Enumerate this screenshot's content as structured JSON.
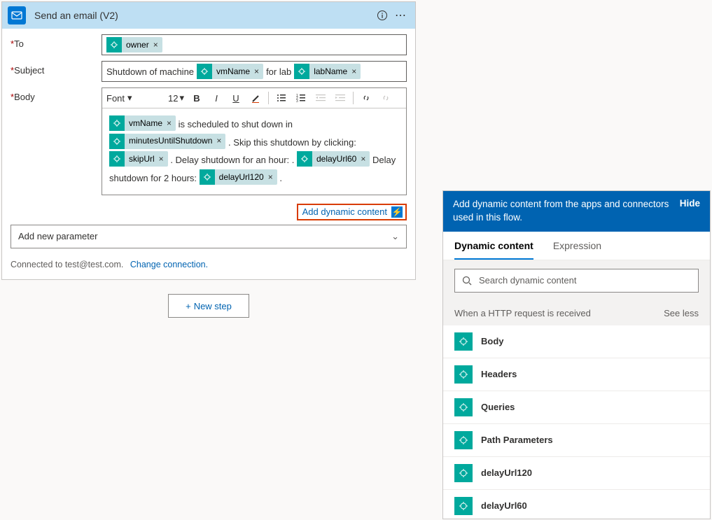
{
  "header": {
    "title": "Send an email (V2)",
    "info_icon": "info-icon",
    "more_icon": "more-icon"
  },
  "fields": {
    "to_label": "To",
    "subject_label": "Subject",
    "body_label": "Body",
    "subject_text_before": "Shutdown of machine",
    "subject_text_mid": "for lab"
  },
  "tokens": {
    "owner": "owner",
    "vmName": "vmName",
    "labName": "labName",
    "minutesUntilShutdown": "minutesUntilShutdown",
    "skipUrl": "skipUrl",
    "delayUrl60": "delayUrl60",
    "delayUrl120": "delayUrl120"
  },
  "body_text": {
    "t1": "is scheduled to shut down in",
    "t2": ". Skip this shutdown by clicking:",
    "t3": ". Delay shutdown for an hour: .",
    "t4": "Delay shutdown for 2 hours:",
    "t5": "."
  },
  "rte": {
    "font_label": "Font",
    "font_size": "12"
  },
  "add_dynamic_label": "Add dynamic content",
  "add_param_label": "Add new parameter",
  "connection": {
    "text": "Connected to test@test.com.",
    "link": "Change connection."
  },
  "new_step_label": "New step",
  "right": {
    "intro": "Add dynamic content from the apps and connectors used in this flow.",
    "hide": "Hide",
    "tab_dynamic": "Dynamic content",
    "tab_expr": "Expression",
    "search_placeholder": "Search dynamic content",
    "section_title": "When a HTTP request is received",
    "see_less": "See less",
    "items": [
      "Body",
      "Headers",
      "Queries",
      "Path Parameters",
      "delayUrl120",
      "delayUrl60"
    ]
  }
}
